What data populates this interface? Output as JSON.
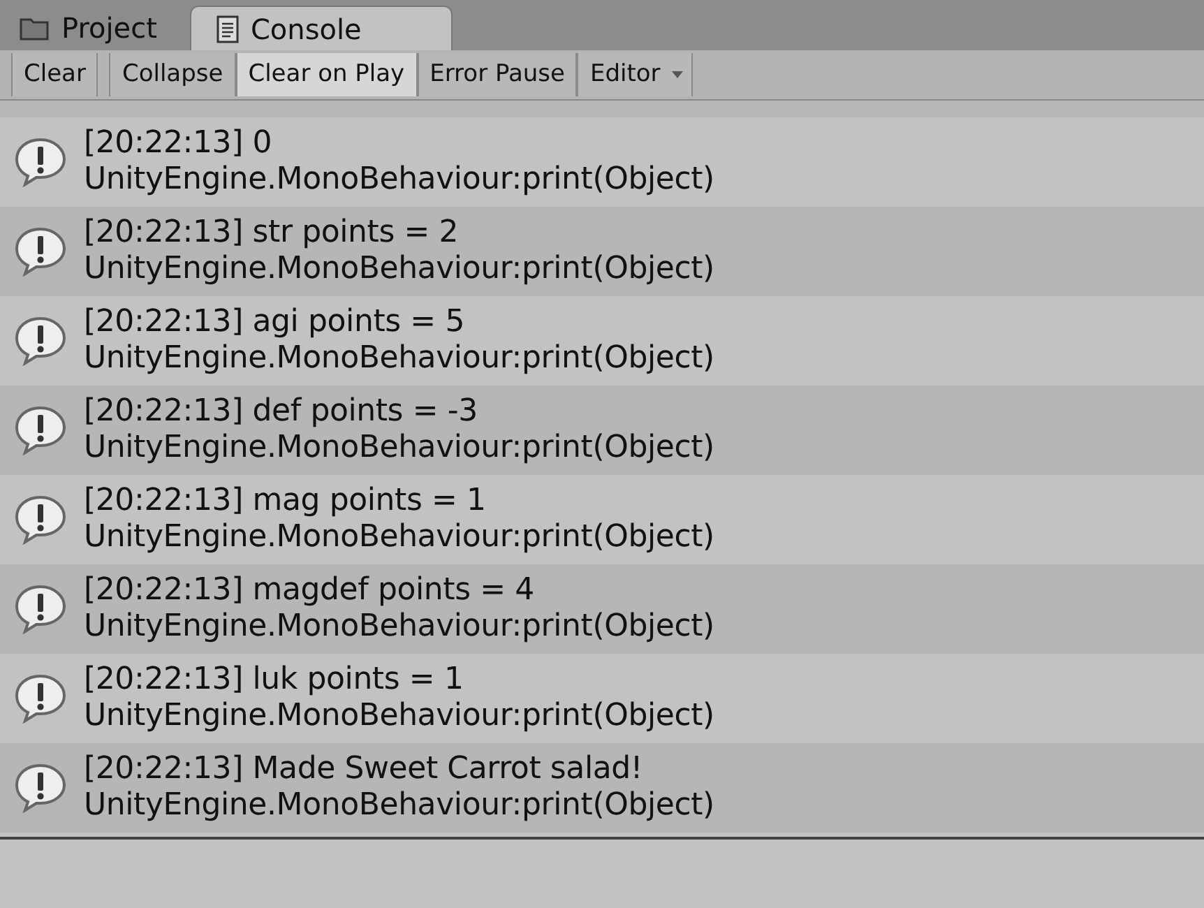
{
  "tabs": [
    {
      "label": "Project",
      "selected": false
    },
    {
      "label": "Console",
      "selected": true
    }
  ],
  "toolbar": [
    {
      "label": "Clear",
      "kind": "button",
      "on": false
    },
    {
      "label": "Collapse",
      "kind": "toggle",
      "on": false
    },
    {
      "label": "Clear on Play",
      "kind": "toggle",
      "on": true
    },
    {
      "label": "Error Pause",
      "kind": "toggle",
      "on": false
    },
    {
      "label": "Editor",
      "kind": "dropdown",
      "on": false
    }
  ],
  "entries": [
    {
      "message": "[20:22:13] 0",
      "source": "UnityEngine.MonoBehaviour:print(Object)"
    },
    {
      "message": "[20:22:13] str points = 2",
      "source": "UnityEngine.MonoBehaviour:print(Object)"
    },
    {
      "message": "[20:22:13] agi points = 5",
      "source": "UnityEngine.MonoBehaviour:print(Object)"
    },
    {
      "message": "[20:22:13] def points = -3",
      "source": "UnityEngine.MonoBehaviour:print(Object)"
    },
    {
      "message": "[20:22:13] mag points = 1",
      "source": "UnityEngine.MonoBehaviour:print(Object)"
    },
    {
      "message": "[20:22:13] magdef points = 4",
      "source": "UnityEngine.MonoBehaviour:print(Object)"
    },
    {
      "message": "[20:22:13] luk points  = 1",
      "source": "UnityEngine.MonoBehaviour:print(Object)"
    },
    {
      "message": "[20:22:13] Made Sweet Carrot salad!",
      "source": "UnityEngine.MonoBehaviour:print(Object)"
    }
  ]
}
